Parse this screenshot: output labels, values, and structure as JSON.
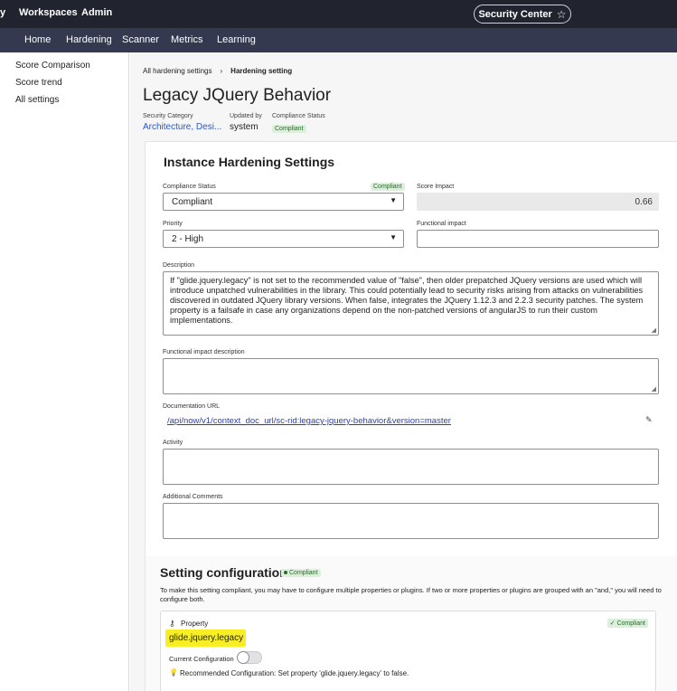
{
  "topbar": {
    "items": [
      "y",
      "Workspaces",
      "Admin"
    ],
    "security_center": "Security Center",
    "star_glyph": "☆"
  },
  "navbar": {
    "items": [
      "Home",
      "Hardening",
      "Scanner",
      "Metrics",
      "Learning"
    ]
  },
  "sidebar": {
    "items": [
      "Score Comparison",
      "Score trend",
      "All settings"
    ]
  },
  "breadcrumb": {
    "parent": "All hardening settings",
    "separator": "›",
    "current": "Hardening setting"
  },
  "page": {
    "title": "Legacy JQuery Behavior",
    "security_category_label": "Security Category",
    "security_category_value": "Architecture, Desi...",
    "updated_by_label": "Updated by",
    "updated_by_value": "system",
    "compliance_status_label": "Compliance Status",
    "compliance_status_value": "Compliant"
  },
  "form": {
    "title": "Instance Hardening Settings",
    "compliance_status_label": "Compliance Status",
    "compliance_badge": "Compliant",
    "compliance_status_value": "Compliant",
    "score_impact_label": "Score Impact",
    "score_impact_value": "0.66",
    "priority_label": "Priority",
    "priority_value": "2 - High",
    "functional_impact_label": "Functional impact",
    "functional_impact_value": "",
    "description_label": "Description",
    "description_value": "If \"glide.jquery.legacy\" is not set to the recommended value of \"false\", then older prepatched JQuery versions are used which will introduce unpatched vulnerabilities in the library. This could potentially lead to security risks arising from attacks on vulnerabilities discovered in outdated JQuery library versions. When false, integrates the JQuery 1.12.3 and 2.2.3 security patches. The system property is a failsafe in case any organizations depend on the non-patched versions of angularJS to run their custom implementations.",
    "functional_impact_desc_label": "Functional impact description",
    "documentation_url_label": "Documentation URL",
    "documentation_url_value": "/api/now/v1/context_doc_url/sc-rid:legacy-jquery-behavior&version=master",
    "activity_label": "Activity",
    "additional_comments_label": "Additional Comments"
  },
  "config": {
    "title": "Setting configuration",
    "badge": "Compliant",
    "help_text": "To make this setting compliant, you may have to configure multiple properties or plugins. If two or more properties or plugins are grouped with an \"and,\" you will need to configure both.",
    "property_label": "Property",
    "property_badge": "Compliant",
    "property_name": "glide.jquery.legacy",
    "current_config_label": "Current Configuration",
    "current_config_on": false,
    "recommended_text": "Recommended Configuration: Set property 'glide.jquery.legacy' to false."
  },
  "colors": {
    "topbar": "#21242f",
    "navbar": "#343950",
    "link": "#2b57c4",
    "highlight": "#f7ef24",
    "compliant_bg": "#dcefdc",
    "compliant_fg": "#2a6b2a"
  },
  "icons": {
    "star": "star-icon",
    "caret": "chevron-down-icon",
    "pencil": "pencil-icon",
    "key": "key-icon",
    "check": "check-circle-icon",
    "bulb": "lightbulb-icon"
  }
}
